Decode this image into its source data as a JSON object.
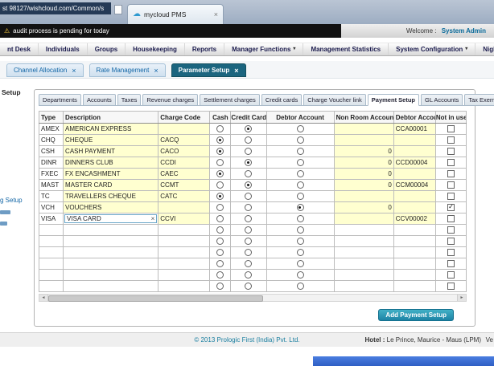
{
  "colors": {
    "accent_teal": "#1b657f",
    "button_teal": "#1d83a5",
    "row_yellow": "#ffffd0",
    "link_blue": "#1266a6"
  },
  "browser": {
    "url": "st 98127/wishcloud.com/Common/s",
    "tab_title": "mycloud PMS",
    "tab_close": "×"
  },
  "notification": {
    "text": "audit process is pending for today",
    "welcome_label": "Welcome :",
    "user": "System Admin"
  },
  "menu": {
    "items": [
      {
        "label": "nt Desk",
        "dropdown": false
      },
      {
        "label": "Individuals",
        "dropdown": false
      },
      {
        "label": "Groups",
        "dropdown": false
      },
      {
        "label": "Housekeeping",
        "dropdown": false
      },
      {
        "label": "Reports",
        "dropdown": false
      },
      {
        "label": "Manager Functions",
        "dropdown": true
      },
      {
        "label": "Management Statistics",
        "dropdown": false
      },
      {
        "label": "System Configuration",
        "dropdown": true
      },
      {
        "label": "Night Audit",
        "dropdown": false
      }
    ]
  },
  "workspace_tabs": [
    {
      "label": "Channel Allocation",
      "active": false
    },
    {
      "label": "Rate Management",
      "active": false
    },
    {
      "label": "Parameter Setup",
      "active": true
    }
  ],
  "sidebar": {
    "heading_fragment": "Setup",
    "link_fragment": "g Setup"
  },
  "panel": {
    "tabs": [
      "Departments",
      "Accounts",
      "Taxes",
      "Revenue charges",
      "Settlement charges",
      "Credit cards",
      "Charge Voucher link",
      "Payment Setup",
      "GL Accounts",
      "Tax Exempt"
    ],
    "active_tab": "Payment Setup",
    "add_button": "Add Payment Setup",
    "table": {
      "columns": [
        "Type",
        "Description",
        "Charge Code",
        "Cash",
        "Credit Card",
        "Debtor Account",
        "Non Room Account",
        "Debtor Account",
        "Not in use"
      ],
      "rows": [
        {
          "type": "AMEX",
          "description": "AMERICAN EXPRESS",
          "charge_code": "",
          "cash": false,
          "credit_card": true,
          "debtor": false,
          "non_room_account": "",
          "debtor_account": "CCA00001",
          "not_in_use": false,
          "editing": false
        },
        {
          "type": "CHQ",
          "description": "CHEQUE",
          "charge_code": "CACQ",
          "cash": true,
          "credit_card": false,
          "debtor": false,
          "non_room_account": "",
          "debtor_account": "",
          "not_in_use": false,
          "editing": false
        },
        {
          "type": "CSH",
          "description": "CASH PAYMENT",
          "charge_code": "CACO",
          "cash": true,
          "credit_card": false,
          "debtor": false,
          "non_room_account": "0",
          "debtor_account": "",
          "not_in_use": false,
          "editing": false
        },
        {
          "type": "DINR",
          "description": "DINNERS CLUB",
          "charge_code": "CCDI",
          "cash": false,
          "credit_card": true,
          "debtor": false,
          "non_room_account": "0",
          "debtor_account": "CCD00004",
          "not_in_use": false,
          "editing": false
        },
        {
          "type": "FXEC",
          "description": "FX ENCASHMENT",
          "charge_code": "CAEC",
          "cash": true,
          "credit_card": false,
          "debtor": false,
          "non_room_account": "0",
          "debtor_account": "",
          "not_in_use": false,
          "editing": false
        },
        {
          "type": "MAST",
          "description": "MASTER CARD",
          "charge_code": "CCMT",
          "cash": false,
          "credit_card": true,
          "debtor": false,
          "non_room_account": "0",
          "debtor_account": "CCM00004",
          "not_in_use": false,
          "editing": false
        },
        {
          "type": "TC",
          "description": "TRAVELLERS CHEQUE",
          "charge_code": "CATC",
          "cash": true,
          "credit_card": false,
          "debtor": false,
          "non_room_account": "",
          "debtor_account": "",
          "not_in_use": false,
          "editing": false
        },
        {
          "type": "VCH",
          "description": "VOUCHERS",
          "charge_code": "",
          "cash": false,
          "credit_card": false,
          "debtor": true,
          "non_room_account": "0",
          "debtor_account": "",
          "not_in_use": true,
          "editing": false
        },
        {
          "type": "VISA",
          "description": "VISA CARD",
          "charge_code": "CCVI",
          "cash": false,
          "credit_card": false,
          "debtor": false,
          "non_room_account": "",
          "debtor_account": "CCV00002",
          "not_in_use": false,
          "editing": true
        }
      ],
      "empty_rows": 6
    }
  },
  "footer": {
    "copyright": "© 2013 Prologic First (India) Pvt. Ltd.",
    "hotel_label": "Hotel :",
    "hotel_value": "Le Prince, Maurice - Maus (LPM)",
    "right_fragment": "Ve"
  }
}
